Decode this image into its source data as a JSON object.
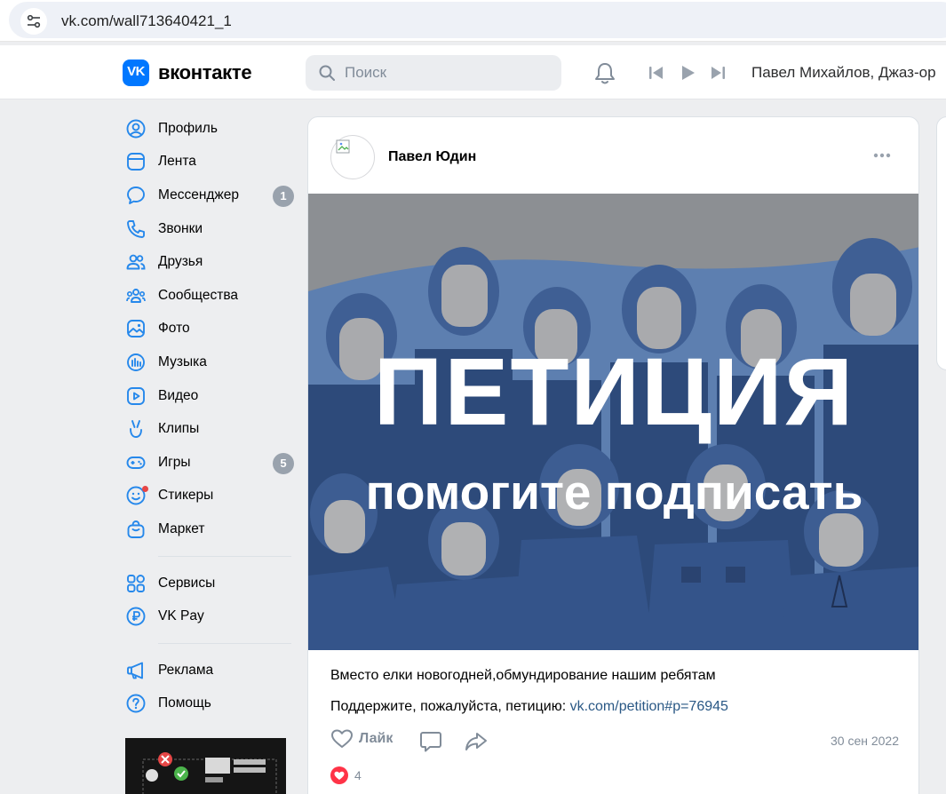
{
  "browser": {
    "url": "vk.com/wall713640421_1"
  },
  "header": {
    "logo_mark": "VK",
    "logo_text": "вконтакте",
    "search_placeholder": "Поиск",
    "now_playing": "Павел Михайлов, Джаз-ор"
  },
  "sidebar": {
    "items": [
      {
        "label": "Профиль",
        "icon": "user-circle-icon"
      },
      {
        "label": "Лента",
        "icon": "newsfeed-icon"
      },
      {
        "label": "Мессенджер",
        "icon": "message-icon",
        "badge": "1"
      },
      {
        "label": "Звонки",
        "icon": "phone-icon"
      },
      {
        "label": "Друзья",
        "icon": "friends-icon"
      },
      {
        "label": "Сообщества",
        "icon": "groups-icon"
      },
      {
        "label": "Фото",
        "icon": "photo-icon"
      },
      {
        "label": "Музыка",
        "icon": "music-icon"
      },
      {
        "label": "Видео",
        "icon": "video-icon"
      },
      {
        "label": "Клипы",
        "icon": "clips-icon"
      },
      {
        "label": "Игры",
        "icon": "gamepad-icon",
        "badge": "5"
      },
      {
        "label": "Стикеры",
        "icon": "smile-icon"
      },
      {
        "label": "Маркет",
        "icon": "market-bag-icon"
      }
    ],
    "services": [
      {
        "label": "Сервисы",
        "icon": "services-grid-icon"
      },
      {
        "label": "VK Pay",
        "icon": "ruble-icon"
      }
    ],
    "extra": [
      {
        "label": "Реклама",
        "icon": "megaphone-icon"
      },
      {
        "label": "Помощь",
        "icon": "help-icon"
      }
    ]
  },
  "post": {
    "author": "Павел Юдин",
    "image_title": "ПЕТИЦИЯ",
    "image_subtitle": "помогите подписать",
    "text_line1": "Вместо елки новогодней,обмундирование нашим ребятам",
    "text_line2_prefix": "Поддержите, пожалуйста, петицию: ",
    "text_link": "vk.com/petition#p=76945",
    "like_label": "Лайк",
    "date": "30 сен 2022",
    "likes_count": "4"
  },
  "colors": {
    "accent": "#0077ff",
    "link": "#2a5885",
    "secondary_text": "#818c99",
    "badge": "#99a2ad",
    "like_red": "#ff3347",
    "icon_blue": "#2688eb"
  }
}
